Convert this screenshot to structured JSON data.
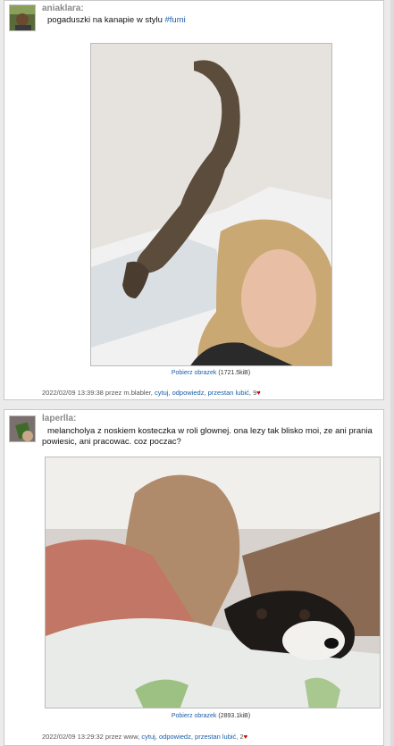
{
  "posts": [
    {
      "username": "aniaklara:",
      "text_before": "pogaduszki na kanapie w stylu ",
      "hashtag": "#fumi",
      "download_label": "Pobierz obrazek",
      "download_size": "(1721.5kiB)",
      "date": "2022/02/09 13:39:38",
      "by_prefix": "przez",
      "author": "m.blabler,",
      "actions": [
        "cytuj,",
        "odpowiedz,",
        "przestan lubić,"
      ],
      "likes": "9"
    },
    {
      "username": "laperlla:",
      "text_line1": "melancholya z noskiem kosteczka w roli glownej. ona lezy tak blisko moi, ze ani prania",
      "text_line2": "powiesic, ani pracowac. coz poczac?",
      "download_label": "Pobierz obrazek",
      "download_size": "(2893.1kiB)",
      "date": "2022/02/09 13:29:32",
      "by_prefix": "przez",
      "author": "www,",
      "actions": [
        "cytuj,",
        "odpowiedz,",
        "przestan lubić,"
      ],
      "likes": "2"
    }
  ],
  "colors": {
    "link": "#1a5ea8",
    "heart": "#d00000",
    "username": "#8a8a8a"
  }
}
